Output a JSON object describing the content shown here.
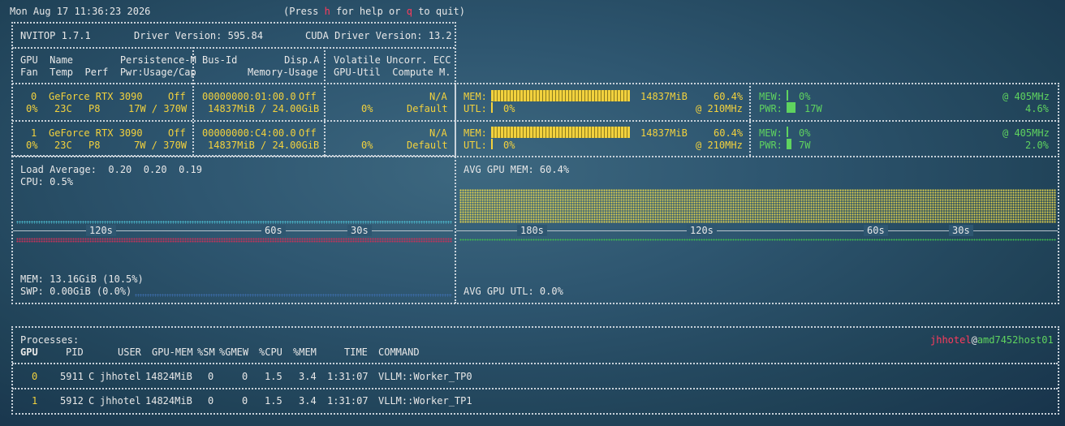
{
  "topbar": {
    "datetime": "Mon Aug 17 11:36:23 2026",
    "help_prefix": "(Press ",
    "help_key": "h",
    "help_mid": " for help or ",
    "quit_key": "q",
    "help_suffix": " to quit)"
  },
  "header": {
    "nvitop": "NVITOP 1.7.1",
    "driver": "Driver Version: 595.84",
    "cuda": "CUDA Driver Version: 13.2",
    "col1_row1": "GPU  Name        Persistence-M",
    "col1_row2": "Fan  Temp  Perf  Pwr:Usage/Cap",
    "col2_row1": "Bus-Id        Disp.A",
    "col2_row2": "Memory-Usage",
    "col3_row1": "Volatile Uncorr. ECC",
    "col3_row2": "GPU-Util  Compute M."
  },
  "gpus": [
    {
      "index": "0",
      "name": "GeForce RTX 3090",
      "persistence": "Off",
      "fan": "0%",
      "temp": "23C",
      "perf": "P8",
      "power": "17W / 370W",
      "bus_id": "00000000:01:00.0",
      "disp": "Off",
      "mem_usage": "14837MiB / 24.00GiB",
      "ecc": "N/A",
      "util": "0%",
      "compute": "Default",
      "mem_label": "MEM:",
      "mem_value": "14837MiB",
      "mem_pct": "60.4%",
      "mem_fraction": 0.604,
      "utl_label": "UTL:",
      "utl_value": "0%",
      "clock": "@ 210MHz",
      "mew_label": "MEW:",
      "mew_value": "0%",
      "mew_clock": "@ 405MHz",
      "pwr_label": "PWR:",
      "pwr_value": "17W",
      "pwr_pct": "4.6%",
      "pwr_fraction": 0.046
    },
    {
      "index": "1",
      "name": "GeForce RTX 3090",
      "persistence": "Off",
      "fan": "0%",
      "temp": "23C",
      "perf": "P8",
      "power": "7W / 370W",
      "bus_id": "00000000:C4:00.0",
      "disp": "Off",
      "mem_usage": "14837MiB / 24.00GiB",
      "ecc": "N/A",
      "util": "0%",
      "compute": "Default",
      "mem_label": "MEM:",
      "mem_value": "14837MiB",
      "mem_pct": "60.4%",
      "mem_fraction": 0.604,
      "utl_label": "UTL:",
      "utl_value": "0%",
      "clock": "@ 210MHz",
      "mew_label": "MEW:",
      "mew_value": "0%",
      "mew_clock": "@ 405MHz",
      "pwr_label": "PWR:",
      "pwr_value": "7W",
      "pwr_pct": "2.0%",
      "pwr_fraction": 0.02
    }
  ],
  "host_panel": {
    "load_average": "Load Average:  0.20  0.20  0.19",
    "cpu": "CPU: 0.5%",
    "mem": "MEM: 13.16GiB (10.5%)",
    "swp": "SWP: 0.00GiB (0.0%)",
    "ticks": [
      "120s",
      "60s",
      "30s"
    ]
  },
  "gpu_panel": {
    "avg_mem": "AVG GPU MEM: 60.4%",
    "avg_utl": "AVG GPU UTL: 0.0%",
    "ticks": [
      "180s",
      "120s",
      "60s",
      "30s"
    ]
  },
  "processes": {
    "title": "Processes:",
    "user": "jhhotel",
    "at": "@",
    "host": "amd7452host01",
    "columns": [
      "GPU",
      "PID",
      "USER",
      "GPU-MEM",
      "%SM",
      "%GMEW",
      "%CPU",
      "%MEM",
      "TIME",
      "COMMAND"
    ],
    "rows": [
      {
        "gpu": "0",
        "pid": "5911",
        "type": "C",
        "user": "jhhotel",
        "gpu_mem": "14824MiB",
        "sm": "0",
        "gmew": "0",
        "cpu": "1.5",
        "mem": "3.4",
        "time": "1:31:07",
        "command": "VLLM::Worker_TP0"
      },
      {
        "gpu": "1",
        "pid": "5912",
        "type": "C",
        "user": "jhhotel",
        "gpu_mem": "14824MiB",
        "sm": "0",
        "gmew": "0",
        "cpu": "1.5",
        "mem": "3.4",
        "time": "1:31:07",
        "command": "VLLM::Worker_TP1"
      }
    ]
  },
  "colors": {
    "accent_yellow": "#f2d13d",
    "accent_green": "#5fd35f",
    "accent_red": "#ff3b5c",
    "graph_cyan": "#4fc3d6",
    "graph_blue": "#3e6fb0"
  }
}
